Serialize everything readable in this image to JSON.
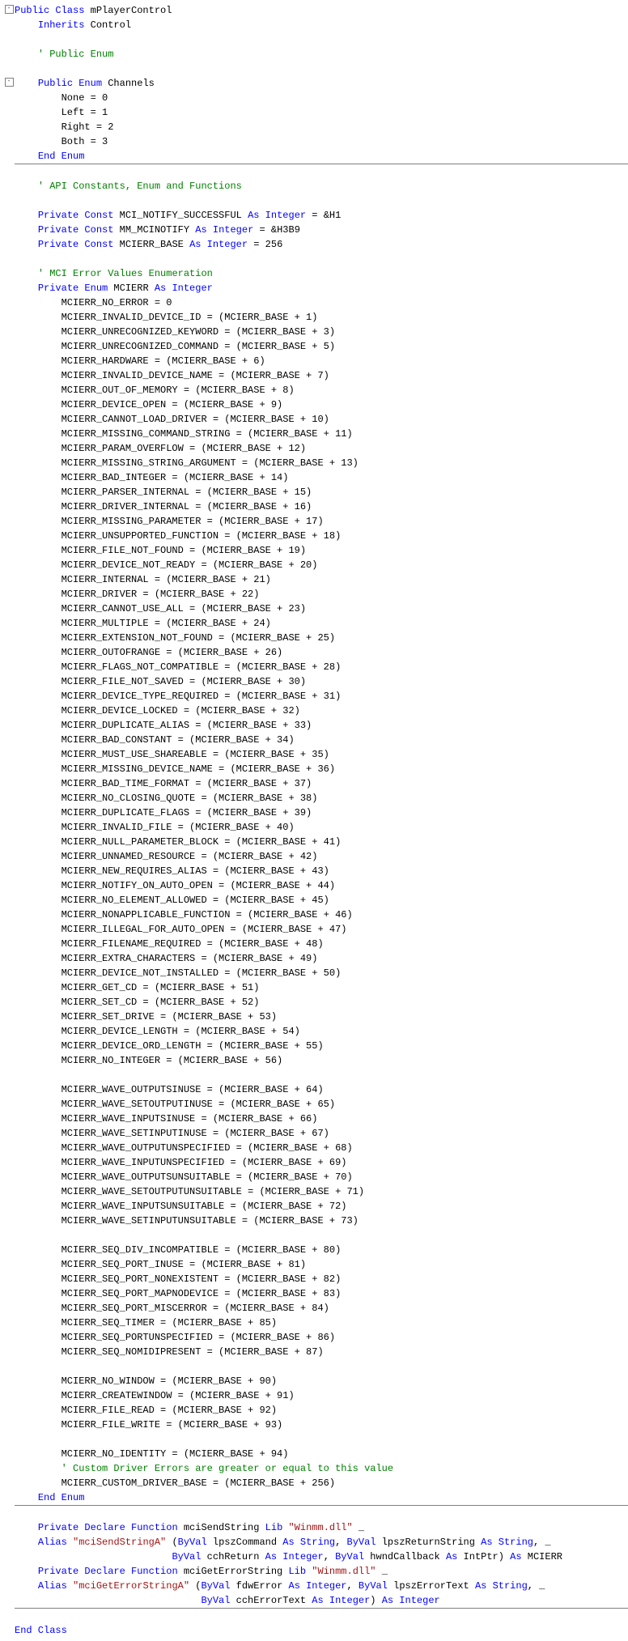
{
  "lang": "VB.NET",
  "class_decl": {
    "kw1": "Public Class",
    "name": " mPlayerControl"
  },
  "inherits": {
    "kw": "Inherits",
    "name": " Control"
  },
  "c_publicenum": "' Public Enum",
  "enum_channels": {
    "decl_kw": "Public Enum",
    "decl_name": " Channels",
    "m0": "None = 0",
    "m1": "Left = 1",
    "m2": "Right = 2",
    "m3": "Both = 3",
    "end": "End Enum"
  },
  "c_api": "' API Constants, Enum and Functions",
  "consts": {
    "c1_kw": "Private Const",
    "c1_n": " MCI_NOTIFY_SUCCESSFUL ",
    "c1_as": "As Integer",
    "c1_v": " = &H1",
    "c2_kw": "Private Const",
    "c2_n": " MM_MCINOTIFY ",
    "c2_as": "As Integer",
    "c2_v": " = &H3B9",
    "c3_kw": "Private Const",
    "c3_n": " MCIERR_BASE ",
    "c3_as": "As Integer",
    "c3_v": " = 256"
  },
  "c_mcierr": "' MCI Error Values Enumeration",
  "enum_mcierr": {
    "decl_kw": "Private Enum",
    "decl_n": " MCIERR ",
    "decl_as": "As Integer",
    "end": "End Enum",
    "m": [
      "MCIERR_NO_ERROR = 0",
      "MCIERR_INVALID_DEVICE_ID = (MCIERR_BASE + 1)",
      "MCIERR_UNRECOGNIZED_KEYWORD = (MCIERR_BASE + 3)",
      "MCIERR_UNRECOGNIZED_COMMAND = (MCIERR_BASE + 5)",
      "MCIERR_HARDWARE = (MCIERR_BASE + 6)",
      "MCIERR_INVALID_DEVICE_NAME = (MCIERR_BASE + 7)",
      "MCIERR_OUT_OF_MEMORY = (MCIERR_BASE + 8)",
      "MCIERR_DEVICE_OPEN = (MCIERR_BASE + 9)",
      "MCIERR_CANNOT_LOAD_DRIVER = (MCIERR_BASE + 10)",
      "MCIERR_MISSING_COMMAND_STRING = (MCIERR_BASE + 11)",
      "MCIERR_PARAM_OVERFLOW = (MCIERR_BASE + 12)",
      "MCIERR_MISSING_STRING_ARGUMENT = (MCIERR_BASE + 13)",
      "MCIERR_BAD_INTEGER = (MCIERR_BASE + 14)",
      "MCIERR_PARSER_INTERNAL = (MCIERR_BASE + 15)",
      "MCIERR_DRIVER_INTERNAL = (MCIERR_BASE + 16)",
      "MCIERR_MISSING_PARAMETER = (MCIERR_BASE + 17)",
      "MCIERR_UNSUPPORTED_FUNCTION = (MCIERR_BASE + 18)",
      "MCIERR_FILE_NOT_FOUND = (MCIERR_BASE + 19)",
      "MCIERR_DEVICE_NOT_READY = (MCIERR_BASE + 20)",
      "MCIERR_INTERNAL = (MCIERR_BASE + 21)",
      "MCIERR_DRIVER = (MCIERR_BASE + 22)",
      "MCIERR_CANNOT_USE_ALL = (MCIERR_BASE + 23)",
      "MCIERR_MULTIPLE = (MCIERR_BASE + 24)",
      "MCIERR_EXTENSION_NOT_FOUND = (MCIERR_BASE + 25)",
      "MCIERR_OUTOFRANGE = (MCIERR_BASE + 26)",
      "MCIERR_FLAGS_NOT_COMPATIBLE = (MCIERR_BASE + 28)",
      "MCIERR_FILE_NOT_SAVED = (MCIERR_BASE + 30)",
      "MCIERR_DEVICE_TYPE_REQUIRED = (MCIERR_BASE + 31)",
      "MCIERR_DEVICE_LOCKED = (MCIERR_BASE + 32)",
      "MCIERR_DUPLICATE_ALIAS = (MCIERR_BASE + 33)",
      "MCIERR_BAD_CONSTANT = (MCIERR_BASE + 34)",
      "MCIERR_MUST_USE_SHAREABLE = (MCIERR_BASE + 35)",
      "MCIERR_MISSING_DEVICE_NAME = (MCIERR_BASE + 36)",
      "MCIERR_BAD_TIME_FORMAT = (MCIERR_BASE + 37)",
      "MCIERR_NO_CLOSING_QUOTE = (MCIERR_BASE + 38)",
      "MCIERR_DUPLICATE_FLAGS = (MCIERR_BASE + 39)",
      "MCIERR_INVALID_FILE = (MCIERR_BASE + 40)",
      "MCIERR_NULL_PARAMETER_BLOCK = (MCIERR_BASE + 41)",
      "MCIERR_UNNAMED_RESOURCE = (MCIERR_BASE + 42)",
      "MCIERR_NEW_REQUIRES_ALIAS = (MCIERR_BASE + 43)",
      "MCIERR_NOTIFY_ON_AUTO_OPEN = (MCIERR_BASE + 44)",
      "MCIERR_NO_ELEMENT_ALLOWED = (MCIERR_BASE + 45)",
      "MCIERR_NONAPPLICABLE_FUNCTION = (MCIERR_BASE + 46)",
      "MCIERR_ILLEGAL_FOR_AUTO_OPEN = (MCIERR_BASE + 47)",
      "MCIERR_FILENAME_REQUIRED = (MCIERR_BASE + 48)",
      "MCIERR_EXTRA_CHARACTERS = (MCIERR_BASE + 49)",
      "MCIERR_DEVICE_NOT_INSTALLED = (MCIERR_BASE + 50)",
      "MCIERR_GET_CD = (MCIERR_BASE + 51)",
      "MCIERR_SET_CD = (MCIERR_BASE + 52)",
      "MCIERR_SET_DRIVE = (MCIERR_BASE + 53)",
      "MCIERR_DEVICE_LENGTH = (MCIERR_BASE + 54)",
      "MCIERR_DEVICE_ORD_LENGTH = (MCIERR_BASE + 55)",
      "MCIERR_NO_INTEGER = (MCIERR_BASE + 56)"
    ],
    "wave": [
      "MCIERR_WAVE_OUTPUTSINUSE = (MCIERR_BASE + 64)",
      "MCIERR_WAVE_SETOUTPUTINUSE = (MCIERR_BASE + 65)",
      "MCIERR_WAVE_INPUTSINUSE = (MCIERR_BASE + 66)",
      "MCIERR_WAVE_SETINPUTINUSE = (MCIERR_BASE + 67)",
      "MCIERR_WAVE_OUTPUTUNSPECIFIED = (MCIERR_BASE + 68)",
      "MCIERR_WAVE_INPUTUNSPECIFIED = (MCIERR_BASE + 69)",
      "MCIERR_WAVE_OUTPUTSUNSUITABLE = (MCIERR_BASE + 70)",
      "MCIERR_WAVE_SETOUTPUTUNSUITABLE = (MCIERR_BASE + 71)",
      "MCIERR_WAVE_INPUTSUNSUITABLE = (MCIERR_BASE + 72)",
      "MCIERR_WAVE_SETINPUTUNSUITABLE = (MCIERR_BASE + 73)"
    ],
    "seq": [
      "MCIERR_SEQ_DIV_INCOMPATIBLE = (MCIERR_BASE + 80)",
      "MCIERR_SEQ_PORT_INUSE = (MCIERR_BASE + 81)",
      "MCIERR_SEQ_PORT_NONEXISTENT = (MCIERR_BASE + 82)",
      "MCIERR_SEQ_PORT_MAPNODEVICE = (MCIERR_BASE + 83)",
      "MCIERR_SEQ_PORT_MISCERROR = (MCIERR_BASE + 84)",
      "MCIERR_SEQ_TIMER = (MCIERR_BASE + 85)",
      "MCIERR_SEQ_PORTUNSPECIFIED = (MCIERR_BASE + 86)",
      "MCIERR_SEQ_NOMIDIPRESENT = (MCIERR_BASE + 87)"
    ],
    "win": [
      "MCIERR_NO_WINDOW = (MCIERR_BASE + 90)",
      "MCIERR_CREATEWINDOW = (MCIERR_BASE + 91)",
      "MCIERR_FILE_READ = (MCIERR_BASE + 92)",
      "MCIERR_FILE_WRITE = (MCIERR_BASE + 93)"
    ],
    "ident": "MCIERR_NO_IDENTITY = (MCIERR_BASE + 94)",
    "c_custom": "' Custom Driver Errors are greater or equal to this value",
    "custom": "MCIERR_CUSTOM_DRIVER_BASE = (MCIERR_BASE + 256)"
  },
  "decl1": {
    "l1_kw": "Private Declare Function",
    "l1_n": " mciSendString ",
    "l1_lib": "Lib",
    "l1_s": " \"Winmm.dll\"",
    "l1_c": " _",
    "l2_a": "Alias",
    "l2_s": " \"mciSendStringA\"",
    "l2_p1": " (",
    "l2_byv1": "ByVal",
    "l2_p2": " lpszCommand ",
    "l2_as1": "As String",
    "l2_sep1": ", ",
    "l2_byv2": "ByVal",
    "l2_p3": " lpszReturnString ",
    "l2_as2": "As String",
    "l2_sep2": ", _",
    "l3_byv1": "ByVal",
    "l3_p1": " cchReturn ",
    "l3_as1": "As Integer",
    "l3_sep1": ", ",
    "l3_byv2": "ByVal",
    "l3_p2": " hwndCallback ",
    "l3_as2": "As",
    "l3_p3": " IntPtr) ",
    "l3_as3": "As",
    "l3_ret": " MCIERR"
  },
  "decl2": {
    "l1_kw": "Private Declare Function",
    "l1_n": " mciGetErrorString ",
    "l1_lib": "Lib",
    "l1_s": " \"Winmm.dll\"",
    "l1_c": " _",
    "l2_a": "Alias",
    "l2_s": " \"mciGetErrorStringA\"",
    "l2_p1": " (",
    "l2_byv1": "ByVal",
    "l2_p2": " fdwError ",
    "l2_as1": "As Integer",
    "l2_sep1": ", ",
    "l2_byv2": "ByVal",
    "l2_p3": " lpszErrorText ",
    "l2_as2": "As String",
    "l2_sep2": ", _",
    "l3_byv1": "ByVal",
    "l3_p1": " cchErrorText ",
    "l3_as1": "As Integer",
    "l3_p2": ") ",
    "l3_as2": "As Integer"
  },
  "end_class": "End Class"
}
